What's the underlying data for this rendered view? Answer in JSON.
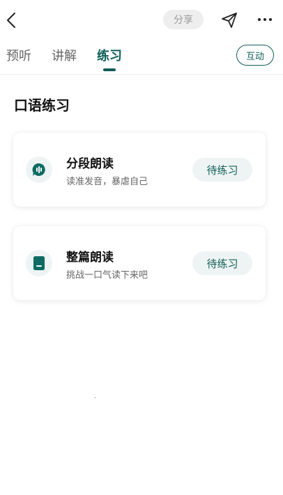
{
  "header": {
    "share_label": "分享"
  },
  "tabs": [
    {
      "label": "预听"
    },
    {
      "label": "讲解"
    },
    {
      "label": "练习",
      "active": true
    }
  ],
  "interact_label": "互动",
  "section": {
    "title": "口语练习"
  },
  "cards": [
    {
      "title": "分段朗读",
      "desc": "读准发音，暴虐自己",
      "status": "待练习",
      "icon": "mic-bubble-icon"
    },
    {
      "title": "整篇朗读",
      "desc": "挑战一口气读下来吧",
      "status": "待练习",
      "icon": "document-icon"
    }
  ],
  "colors": {
    "accent": "#0d5e57",
    "accent_light": "#eef4f3"
  }
}
